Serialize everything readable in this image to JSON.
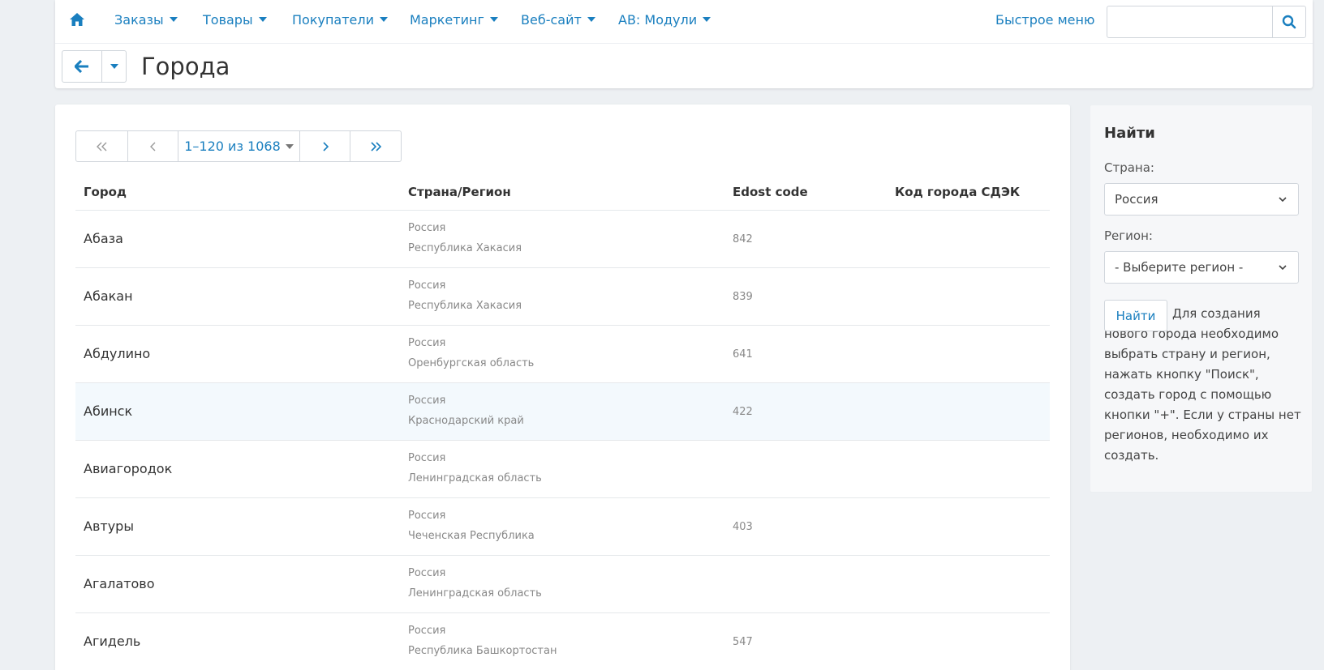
{
  "nav": {
    "items": [
      {
        "label": "Заказы"
      },
      {
        "label": "Товары"
      },
      {
        "label": "Покупатели"
      },
      {
        "label": "Маркетинг"
      },
      {
        "label": "Веб-сайт"
      },
      {
        "label": "АВ: Модули"
      }
    ],
    "quick_menu": "Быстрое меню",
    "search_placeholder": ""
  },
  "page": {
    "title": "Города"
  },
  "pager": {
    "range": "1–120 из 1068"
  },
  "table": {
    "headers": {
      "city": "Город",
      "country_region": "Страна/Регион",
      "edost": "Edost code",
      "cdek": "Код города СДЭК"
    },
    "rows": [
      {
        "city": "Абаза",
        "country": "Россия",
        "region": "Республика Хакасия",
        "edost": "842",
        "cdek": ""
      },
      {
        "city": "Абакан",
        "country": "Россия",
        "region": "Республика Хакасия",
        "edost": "839",
        "cdek": ""
      },
      {
        "city": "Абдулино",
        "country": "Россия",
        "region": "Оренбургская область",
        "edost": "641",
        "cdek": ""
      },
      {
        "city": "Абинск",
        "country": "Россия",
        "region": "Краснодарский край",
        "edost": "422",
        "cdek": ""
      },
      {
        "city": "Авиагородок",
        "country": "Россия",
        "region": "Ленинградская область",
        "edost": "",
        "cdek": ""
      },
      {
        "city": "Автуры",
        "country": "Россия",
        "region": "Чеченская Республика",
        "edost": "403",
        "cdek": ""
      },
      {
        "city": "Агалатово",
        "country": "Россия",
        "region": "Ленинградская область",
        "edost": "",
        "cdek": ""
      },
      {
        "city": "Агидель",
        "country": "Россия",
        "region": "Республика Башкортостан",
        "edost": "547",
        "cdek": ""
      }
    ]
  },
  "sidebar": {
    "title": "Найти",
    "country_label": "Страна:",
    "country_value": "Россия",
    "region_label": "Регион:",
    "region_value": "- Выберите регион -",
    "find_button": "Найти",
    "help_text": "Для создания нового города необходимо выбрать страну и регион, нажать кнопку \"Поиск\", создать город с помощью кнопки \"+\". Если у страны нет регионов, необходимо их создать."
  },
  "colors": {
    "accent": "#1a7fbf",
    "background": "#edf0f3",
    "highlight_row": "#f3f9fd"
  }
}
